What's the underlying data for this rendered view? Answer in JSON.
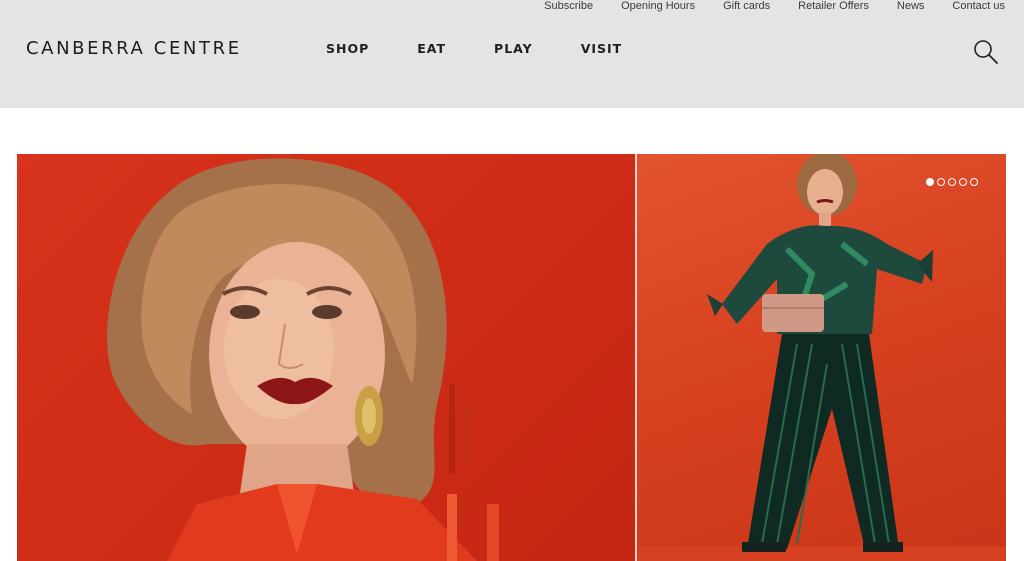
{
  "utility_nav": [
    "Subscribe",
    "Opening Hours",
    "Gift cards",
    "Retailer Offers",
    "News",
    "Contact us"
  ],
  "brand": {
    "logo_text": "CANBERRA CENTRE"
  },
  "main_nav": [
    "SHOP",
    "EAT",
    "PLAY",
    "VISIT"
  ],
  "icons": {
    "search": "search-icon"
  },
  "carousel": {
    "slide_count": 5,
    "active_index": 0
  },
  "colors": {
    "header_bg": "#e4e4e2",
    "hero_red": "#d8331c"
  }
}
